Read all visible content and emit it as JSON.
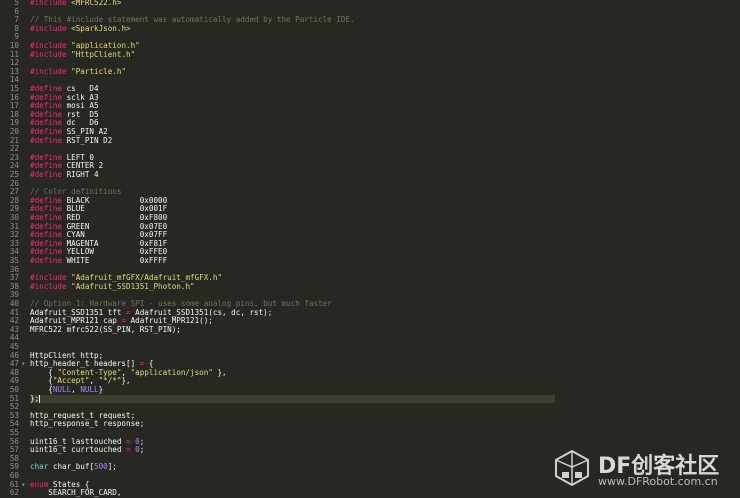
{
  "editor": {
    "lines": [
      {
        "n": "5",
        "c": [
          [
            "kw",
            "#include "
          ],
          [
            "str",
            "<MFRC522.h>"
          ]
        ]
      },
      {
        "n": "6",
        "c": []
      },
      {
        "n": "7",
        "c": [
          [
            "cmt",
            "// This #include statement was automatically added by the Particle IDE."
          ]
        ]
      },
      {
        "n": "8",
        "c": [
          [
            "kw",
            "#include "
          ],
          [
            "str",
            "<SparkJson.h>"
          ]
        ]
      },
      {
        "n": "9",
        "c": []
      },
      {
        "n": "10",
        "c": [
          [
            "kw",
            "#include "
          ],
          [
            "str",
            "\"application.h\""
          ]
        ]
      },
      {
        "n": "11",
        "c": [
          [
            "kw",
            "#include "
          ],
          [
            "str",
            "\"HttpClient.h\""
          ]
        ]
      },
      {
        "n": "12",
        "c": []
      },
      {
        "n": "13",
        "c": [
          [
            "kw",
            "#include "
          ],
          [
            "str",
            "\"Particle.h\""
          ]
        ]
      },
      {
        "n": "14",
        "c": []
      },
      {
        "n": "15",
        "c": [
          [
            "kw",
            "#define "
          ],
          [
            "",
            "cs   D4"
          ]
        ]
      },
      {
        "n": "16",
        "c": [
          [
            "kw",
            "#define "
          ],
          [
            "",
            "sclk A3"
          ]
        ]
      },
      {
        "n": "17",
        "c": [
          [
            "kw",
            "#define "
          ],
          [
            "",
            "mosi A5"
          ]
        ]
      },
      {
        "n": "18",
        "c": [
          [
            "kw",
            "#define "
          ],
          [
            "",
            "rst  D5"
          ]
        ]
      },
      {
        "n": "19",
        "c": [
          [
            "kw",
            "#define "
          ],
          [
            "",
            "dc   D6"
          ]
        ]
      },
      {
        "n": "20",
        "c": [
          [
            "kw",
            "#define "
          ],
          [
            "",
            "SS_PIN A2"
          ]
        ]
      },
      {
        "n": "21",
        "c": [
          [
            "kw",
            "#define "
          ],
          [
            "",
            "RST_PIN D2"
          ]
        ]
      },
      {
        "n": "22",
        "c": []
      },
      {
        "n": "23",
        "c": [
          [
            "kw",
            "#define "
          ],
          [
            "",
            "LEFT 0"
          ]
        ]
      },
      {
        "n": "24",
        "c": [
          [
            "kw",
            "#define "
          ],
          [
            "",
            "CENTER 2"
          ]
        ]
      },
      {
        "n": "25",
        "c": [
          [
            "kw",
            "#define "
          ],
          [
            "",
            "RIGHT 4"
          ]
        ]
      },
      {
        "n": "26",
        "c": []
      },
      {
        "n": "27",
        "c": [
          [
            "cmt",
            "// Color definitions"
          ]
        ]
      },
      {
        "n": "28",
        "c": [
          [
            "kw",
            "#define "
          ],
          [
            "",
            "BLACK           0x0000"
          ]
        ]
      },
      {
        "n": "29",
        "c": [
          [
            "kw",
            "#define "
          ],
          [
            "",
            "BLUE            0x001F"
          ]
        ]
      },
      {
        "n": "30",
        "c": [
          [
            "kw",
            "#define "
          ],
          [
            "",
            "RED             0xF800"
          ]
        ]
      },
      {
        "n": "31",
        "c": [
          [
            "kw",
            "#define "
          ],
          [
            "",
            "GREEN           0x07E0"
          ]
        ]
      },
      {
        "n": "32",
        "c": [
          [
            "kw",
            "#define "
          ],
          [
            "",
            "CYAN            0x07FF"
          ]
        ]
      },
      {
        "n": "33",
        "c": [
          [
            "kw",
            "#define "
          ],
          [
            "",
            "MAGENTA         0xF81F"
          ]
        ]
      },
      {
        "n": "34",
        "c": [
          [
            "kw",
            "#define "
          ],
          [
            "",
            "YELLOW          0xFFE0"
          ]
        ]
      },
      {
        "n": "35",
        "c": [
          [
            "kw",
            "#define "
          ],
          [
            "",
            "WHITE           0xFFFF"
          ]
        ]
      },
      {
        "n": "36",
        "c": []
      },
      {
        "n": "37",
        "c": [
          [
            "kw",
            "#include "
          ],
          [
            "str",
            "\"Adafruit_mfGFX/Adafruit_mfGFX.h\""
          ]
        ]
      },
      {
        "n": "38",
        "c": [
          [
            "kw",
            "#include "
          ],
          [
            "str",
            "\"Adafruit_SSD1351_Photon.h\""
          ]
        ]
      },
      {
        "n": "39",
        "c": []
      },
      {
        "n": "40",
        "c": [
          [
            "cmt",
            "// Option 1: Hardware SPI - uses some analog pins, but much faster"
          ]
        ]
      },
      {
        "n": "41",
        "c": [
          [
            "",
            "Adafruit_SSD1351 tft "
          ],
          [
            "kw",
            "="
          ],
          [
            "",
            " Adafruit_SSD1351(cs, dc, rst);"
          ]
        ]
      },
      {
        "n": "42",
        "c": [
          [
            "",
            "Adafruit_MPR121 cap "
          ],
          [
            "kw",
            "="
          ],
          [
            "",
            " Adafruit_MPR121();"
          ]
        ]
      },
      {
        "n": "43",
        "c": [
          [
            "",
            "MFRC522 mfrc522(SS_PIN, RST_PIN);"
          ]
        ]
      },
      {
        "n": "44",
        "c": []
      },
      {
        "n": "45",
        "c": []
      },
      {
        "n": "46",
        "c": [
          [
            "",
            "HttpClient http;"
          ]
        ]
      },
      {
        "n": "47",
        "f": "▾",
        "c": [
          [
            "",
            "http_header_t headers[] "
          ],
          [
            "kw",
            "="
          ],
          [
            "",
            " {"
          ]
        ]
      },
      {
        "n": "48",
        "c": [
          [
            "",
            "    { "
          ],
          [
            "str",
            "\"Content-Type\""
          ],
          [
            "",
            ", "
          ],
          [
            "str",
            "\"application/json\""
          ],
          [
            "",
            " },"
          ]
        ]
      },
      {
        "n": "49",
        "c": [
          [
            "",
            "    {"
          ],
          [
            "str",
            "\"Accept\""
          ],
          [
            "",
            ", "
          ],
          [
            "str",
            "\"*/*\""
          ],
          [
            "",
            "},"
          ]
        ]
      },
      {
        "n": "50",
        "c": [
          [
            "",
            "    {"
          ],
          [
            "num",
            "NULL"
          ],
          [
            "",
            ", "
          ],
          [
            "num",
            "NULL"
          ],
          [
            "",
            "}"
          ]
        ]
      },
      {
        "n": "51",
        "cur": true,
        "c": [
          [
            "",
            "};"
          ]
        ]
      },
      {
        "n": "52",
        "c": []
      },
      {
        "n": "53",
        "c": [
          [
            "",
            "http_request_t request;"
          ]
        ]
      },
      {
        "n": "54",
        "c": [
          [
            "",
            "http_response_t response;"
          ]
        ]
      },
      {
        "n": "55",
        "c": []
      },
      {
        "n": "56",
        "c": [
          [
            "",
            "uint16_t lasttouched "
          ],
          [
            "kw",
            "="
          ],
          [
            "",
            " "
          ],
          [
            "num",
            "0"
          ],
          [
            "",
            ";"
          ]
        ]
      },
      {
        "n": "57",
        "c": [
          [
            "",
            "uint16_t currtouched "
          ],
          [
            "kw",
            "="
          ],
          [
            "",
            " "
          ],
          [
            "num",
            "0"
          ],
          [
            "",
            ";"
          ]
        ]
      },
      {
        "n": "58",
        "c": []
      },
      {
        "n": "59",
        "c": [
          [
            "type",
            "char"
          ],
          [
            "",
            " char_buf["
          ],
          [
            "num",
            "500"
          ],
          [
            "",
            "];"
          ]
        ]
      },
      {
        "n": "60",
        "c": []
      },
      {
        "n": "61",
        "f": "▾",
        "c": [
          [
            "kw",
            "enum"
          ],
          [
            "",
            " States {"
          ]
        ]
      },
      {
        "n": "62",
        "c": [
          [
            "",
            "    SEARCH_FOR_CARD,"
          ]
        ]
      }
    ]
  },
  "watermark": {
    "title": "DF创客社区",
    "url": "www.DFRobot.com.cn",
    "colors": {
      "text": "#d8d8d8",
      "logo": "#cfcfcf"
    }
  }
}
